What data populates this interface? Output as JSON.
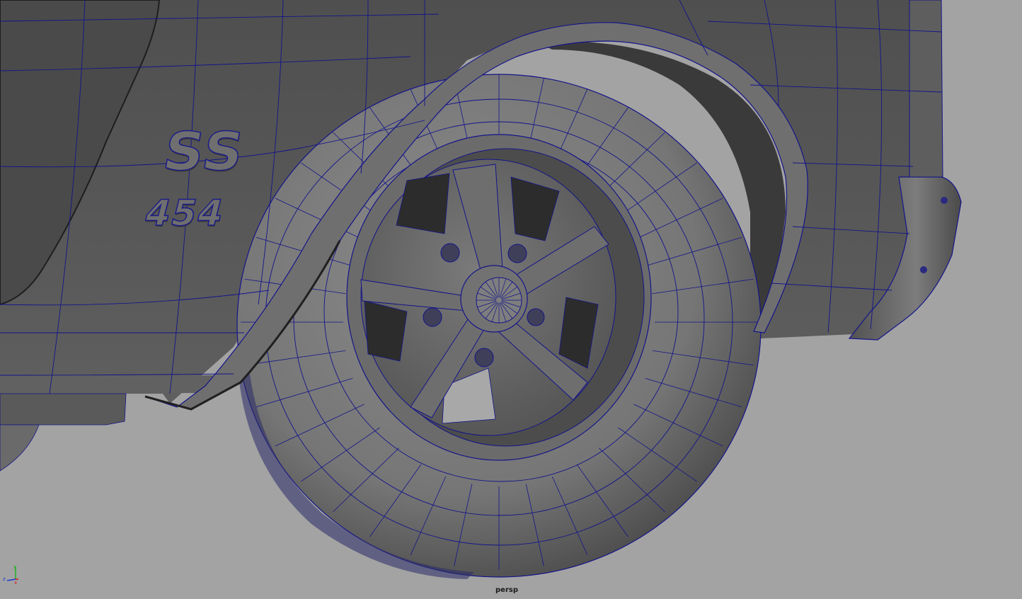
{
  "viewport": {
    "camera_label": "persp",
    "wire_color": "#14148a",
    "background": "#a3a3a3",
    "body_color": "#5c5c5c",
    "tire_color": "#7a7a7a",
    "rim_color": "#6e6e6e"
  },
  "emblem": {
    "top": "SS",
    "bottom": "454"
  },
  "axis_gizmo": {
    "x_label": "x",
    "y_label": "y",
    "z_label": "z",
    "x_color": "#d01c1c",
    "y_color": "#20b020",
    "z_color": "#1c3cd0"
  }
}
